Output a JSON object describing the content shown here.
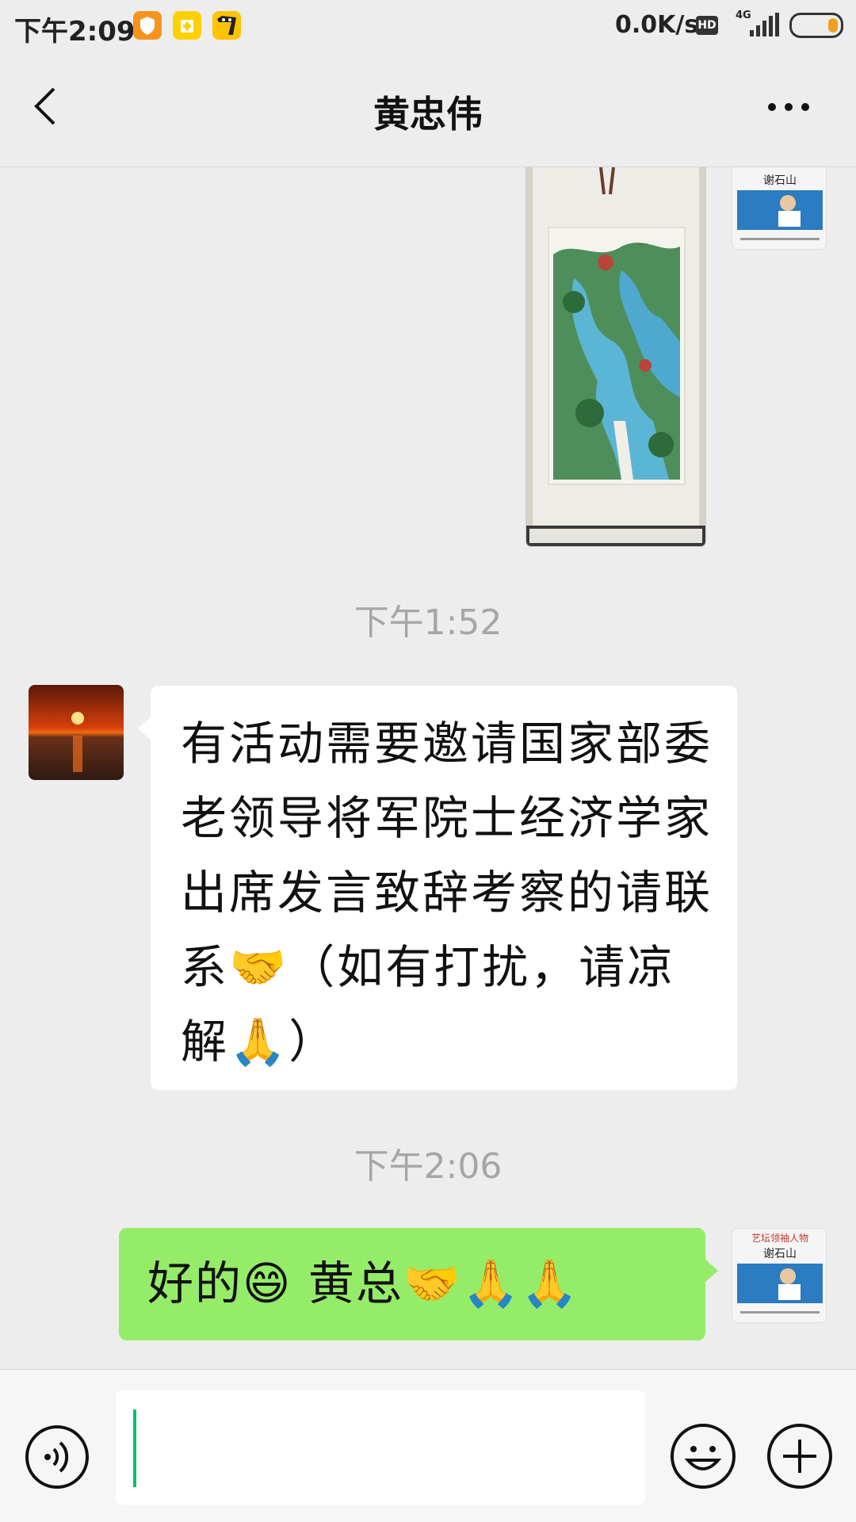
{
  "status_bar": {
    "time": "下午2:09",
    "network_speed": "0.0K/s",
    "hd_label": "HD",
    "network_type": "4G",
    "icons": [
      "shield-app-icon",
      "yellow-app-icon",
      "cat-app-icon",
      "signal-icon",
      "battery-icon"
    ],
    "battery_level": 0.2,
    "battery_color": "#F0A020"
  },
  "header": {
    "title": "黄忠伟",
    "back_icon": "chevron-left-icon",
    "more_icon": "more-dots-icon"
  },
  "messages": [
    {
      "type": "image",
      "direction": "outgoing",
      "description": "scroll-painting",
      "avatar": "book-cover-avatar"
    },
    {
      "type": "timestamp",
      "text": "下午1:52"
    },
    {
      "type": "text",
      "direction": "incoming",
      "avatar": "sunset-avatar",
      "text": "有活动需要邀请国家部委老领导将军院士经济学家出席发言致辞考察的请联系🤝（如有打扰，请凉解🙏）"
    },
    {
      "type": "timestamp",
      "text": "下午2:06"
    },
    {
      "type": "text",
      "direction": "outgoing",
      "avatar": "book-cover-avatar",
      "text": "好的😄 黄总🤝🙏🙏"
    }
  ],
  "book_cover": {
    "top_text": "艺坛领袖人物",
    "name_text": "谢石山"
  },
  "input_bar": {
    "value": "",
    "voice_icon": "voice-icon",
    "emoji_icon": "emoji-icon",
    "plus_icon": "plus-icon"
  },
  "colors": {
    "background": "#EDEDED",
    "outgoing_bubble": "#95EC69",
    "incoming_bubble": "#FFFFFF",
    "accent": "#07C160",
    "timestamp": "#A6A6A6"
  }
}
